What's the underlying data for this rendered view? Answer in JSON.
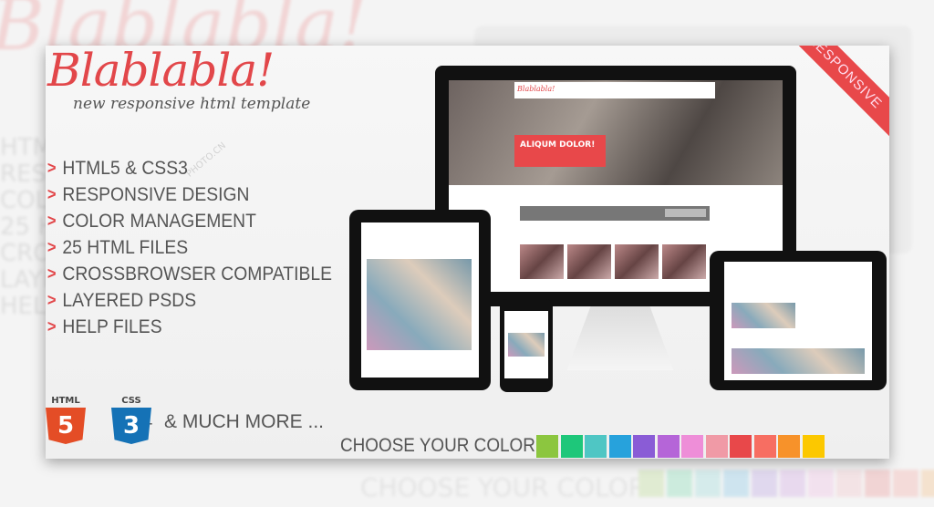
{
  "brand": {
    "logo": "Blablabla!",
    "tagline": "new responsive html template",
    "accent": "#e2474a"
  },
  "ribbon": "RESPONSIVE",
  "features": [
    "HTML5 & CSS3",
    "RESPONSIVE DESIGN",
    "COLOR MANAGEMENT",
    "25 HTML FILES",
    "CROSSBROWSER COMPATIBLE",
    "LAYERED PSDS",
    "HELP FILES"
  ],
  "badges": [
    {
      "label": "HTML",
      "number": "5",
      "color": "#e44d26"
    },
    {
      "label": "CSS",
      "number": "3",
      "color": "#1572b6"
    }
  ],
  "plus": "+",
  "more": "& MUCH MORE ...",
  "preview": {
    "logo": "Blablabla!",
    "hero_title": "ALIQUM DOLOR!"
  },
  "colors": {
    "label": "CHOOSE YOUR COLOR!",
    "swatches": [
      "#8cc63f",
      "#1ec77a",
      "#4fc6c4",
      "#27a2dc",
      "#8a5cd6",
      "#b565d8",
      "#ee8ed8",
      "#f09aa6",
      "#e8484a",
      "#f76e62",
      "#f7922a",
      "#fcc800"
    ]
  },
  "watermark": "PHOTO.CN"
}
